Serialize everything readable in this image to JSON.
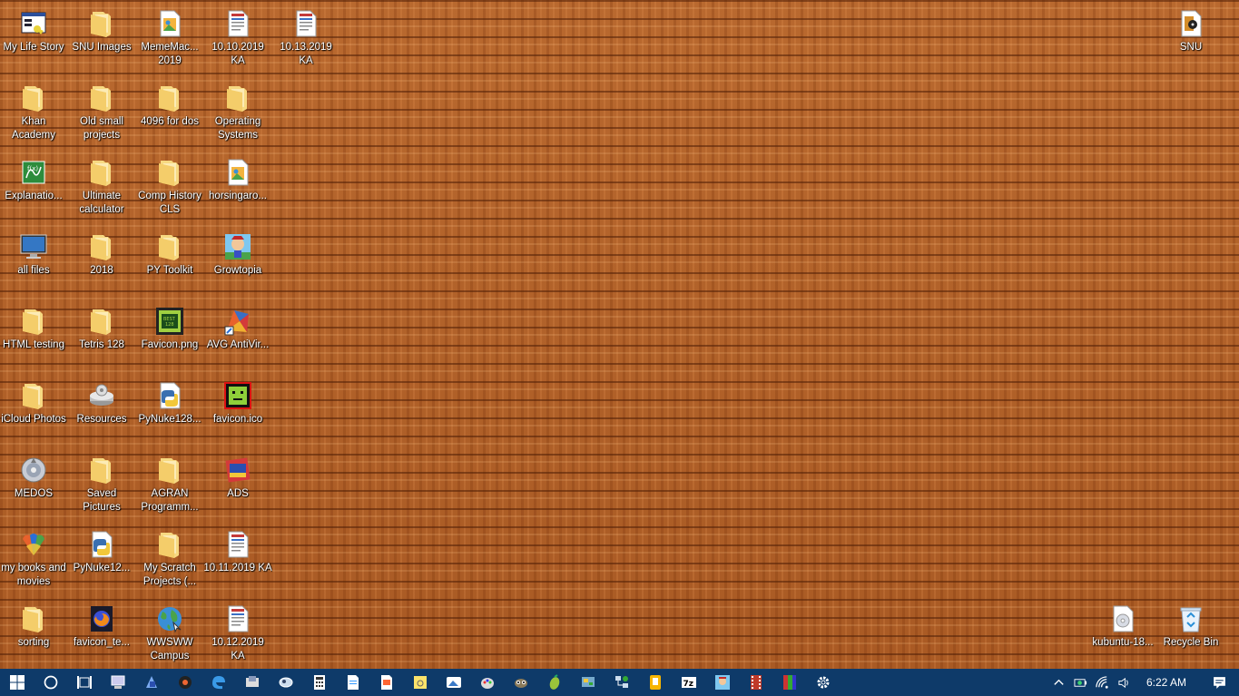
{
  "desktop": {
    "icons": [
      {
        "label": "My Life Story",
        "type": "app-window"
      },
      {
        "label": "SNU Images",
        "type": "folder"
      },
      {
        "label": "MemeMac... 2019",
        "type": "file-image"
      },
      {
        "label": "10.10.2019 KA",
        "type": "file-doc"
      },
      {
        "label": "10.13.2019 KA",
        "type": "file-doc"
      },
      {
        "label": "SNU",
        "type": "file-audio"
      },
      {
        "label": "Khan Academy",
        "type": "folder"
      },
      {
        "label": "Old small projects",
        "type": "folder"
      },
      {
        "label": "4096 for dos",
        "type": "folder"
      },
      {
        "label": "Operating Systems",
        "type": "folder"
      },
      {
        "label": "Explanatio...",
        "type": "file-graph"
      },
      {
        "label": "Ultimate calculator",
        "type": "folder"
      },
      {
        "label": "Comp History CLS",
        "type": "folder"
      },
      {
        "label": "horsingaro...",
        "type": "file-image"
      },
      {
        "label": "all files",
        "type": "monitor"
      },
      {
        "label": "2018",
        "type": "folder"
      },
      {
        "label": "PY Toolkit",
        "type": "folder"
      },
      {
        "label": "Growtopia",
        "type": "app-game"
      },
      {
        "label": "HTML testing",
        "type": "folder"
      },
      {
        "label": "Tetris 128",
        "type": "folder"
      },
      {
        "label": "Favicon.png",
        "type": "image-green"
      },
      {
        "label": "AVG AntiVir...",
        "type": "app-avg"
      },
      {
        "label": "iCloud Photos",
        "type": "folder"
      },
      {
        "label": "Resources",
        "type": "drive"
      },
      {
        "label": "PyNuke128...",
        "type": "python"
      },
      {
        "label": "favicon.ico",
        "type": "image-face"
      },
      {
        "label": "MEDOS",
        "type": "disc"
      },
      {
        "label": "Saved Pictures",
        "type": "folder"
      },
      {
        "label": "AGRAN Programm...",
        "type": "folder"
      },
      {
        "label": "ADS",
        "type": "app-ads"
      },
      {
        "label": "my books and movies",
        "type": "app-msn"
      },
      {
        "label": "PyNuke12...",
        "type": "python"
      },
      {
        "label": "My Scratch Projects (...",
        "type": "folder"
      },
      {
        "label": "10.11.2019 KA",
        "type": "file-doc"
      },
      {
        "label": "sorting",
        "type": "folder"
      },
      {
        "label": "favicon_te...",
        "type": "firefox-file"
      },
      {
        "label": "WWSWW Campus",
        "type": "globe"
      },
      {
        "label": "10.12.2019 KA",
        "type": "file-doc"
      },
      {
        "label": "kubuntu-18...",
        "type": "iso"
      },
      {
        "label": "Recycle Bin",
        "type": "recycle-bin"
      }
    ]
  },
  "taskbar": {
    "apps": [
      "windows-start-icon",
      "cortana-circle-icon",
      "task-view-icon",
      "computer-icon",
      "paint3d-icon",
      "media-icon",
      "edge-icon",
      "mail-icon",
      "people-icon",
      "calculator-icon",
      "notepad-icon",
      "wordpad-icon",
      "sticky-icon",
      "photos-icon",
      "paint-icon",
      "gimp-icon",
      "mango-icon",
      "control-panel-icon",
      "network-icon",
      "note-icon",
      "7zip-icon",
      "game-icon",
      "film-icon",
      "winrar-icon",
      "settings-icon"
    ],
    "clock": "6:22 AM",
    "tray": [
      "chevron-up-icon",
      "battery-icon",
      "wifi-icon",
      "volume-icon"
    ]
  },
  "colors": {
    "taskbar": "#0e3a69",
    "desktop": "#b0622a",
    "folder": "#f4cd6a"
  }
}
